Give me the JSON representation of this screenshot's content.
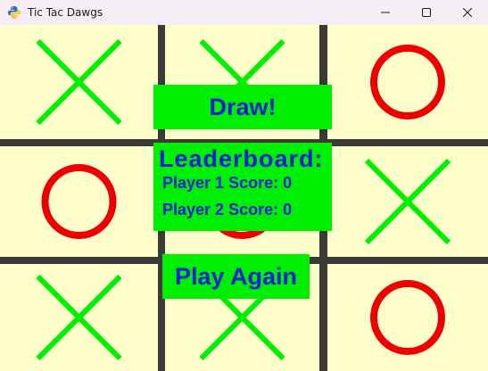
{
  "window": {
    "title": "Tic Tac Dawgs",
    "app_icon": "python-logo-icon",
    "controls": [
      "minimize-icon",
      "maximize-icon",
      "close-icon"
    ]
  },
  "board": {
    "cells": [
      [
        "X",
        "X",
        "O"
      ],
      [
        "O",
        "O",
        "X"
      ],
      [
        "X",
        "X",
        "O"
      ]
    ],
    "colors": {
      "x_mark": "#00ee00",
      "o_mark": "#ee0000",
      "cell_background": "#ffffcc",
      "grid_lines": "#3a3a36"
    }
  },
  "result": {
    "message": "Draw!"
  },
  "leaderboard": {
    "title": "Leaderboard:",
    "player1": "Player 1 Score: 0",
    "player2": "Player 2 Score: 0"
  },
  "actions": {
    "play_again_label": "Play Again"
  },
  "overlay_colors": {
    "box_background": "#00ee00",
    "text": "#0f1fd6"
  }
}
